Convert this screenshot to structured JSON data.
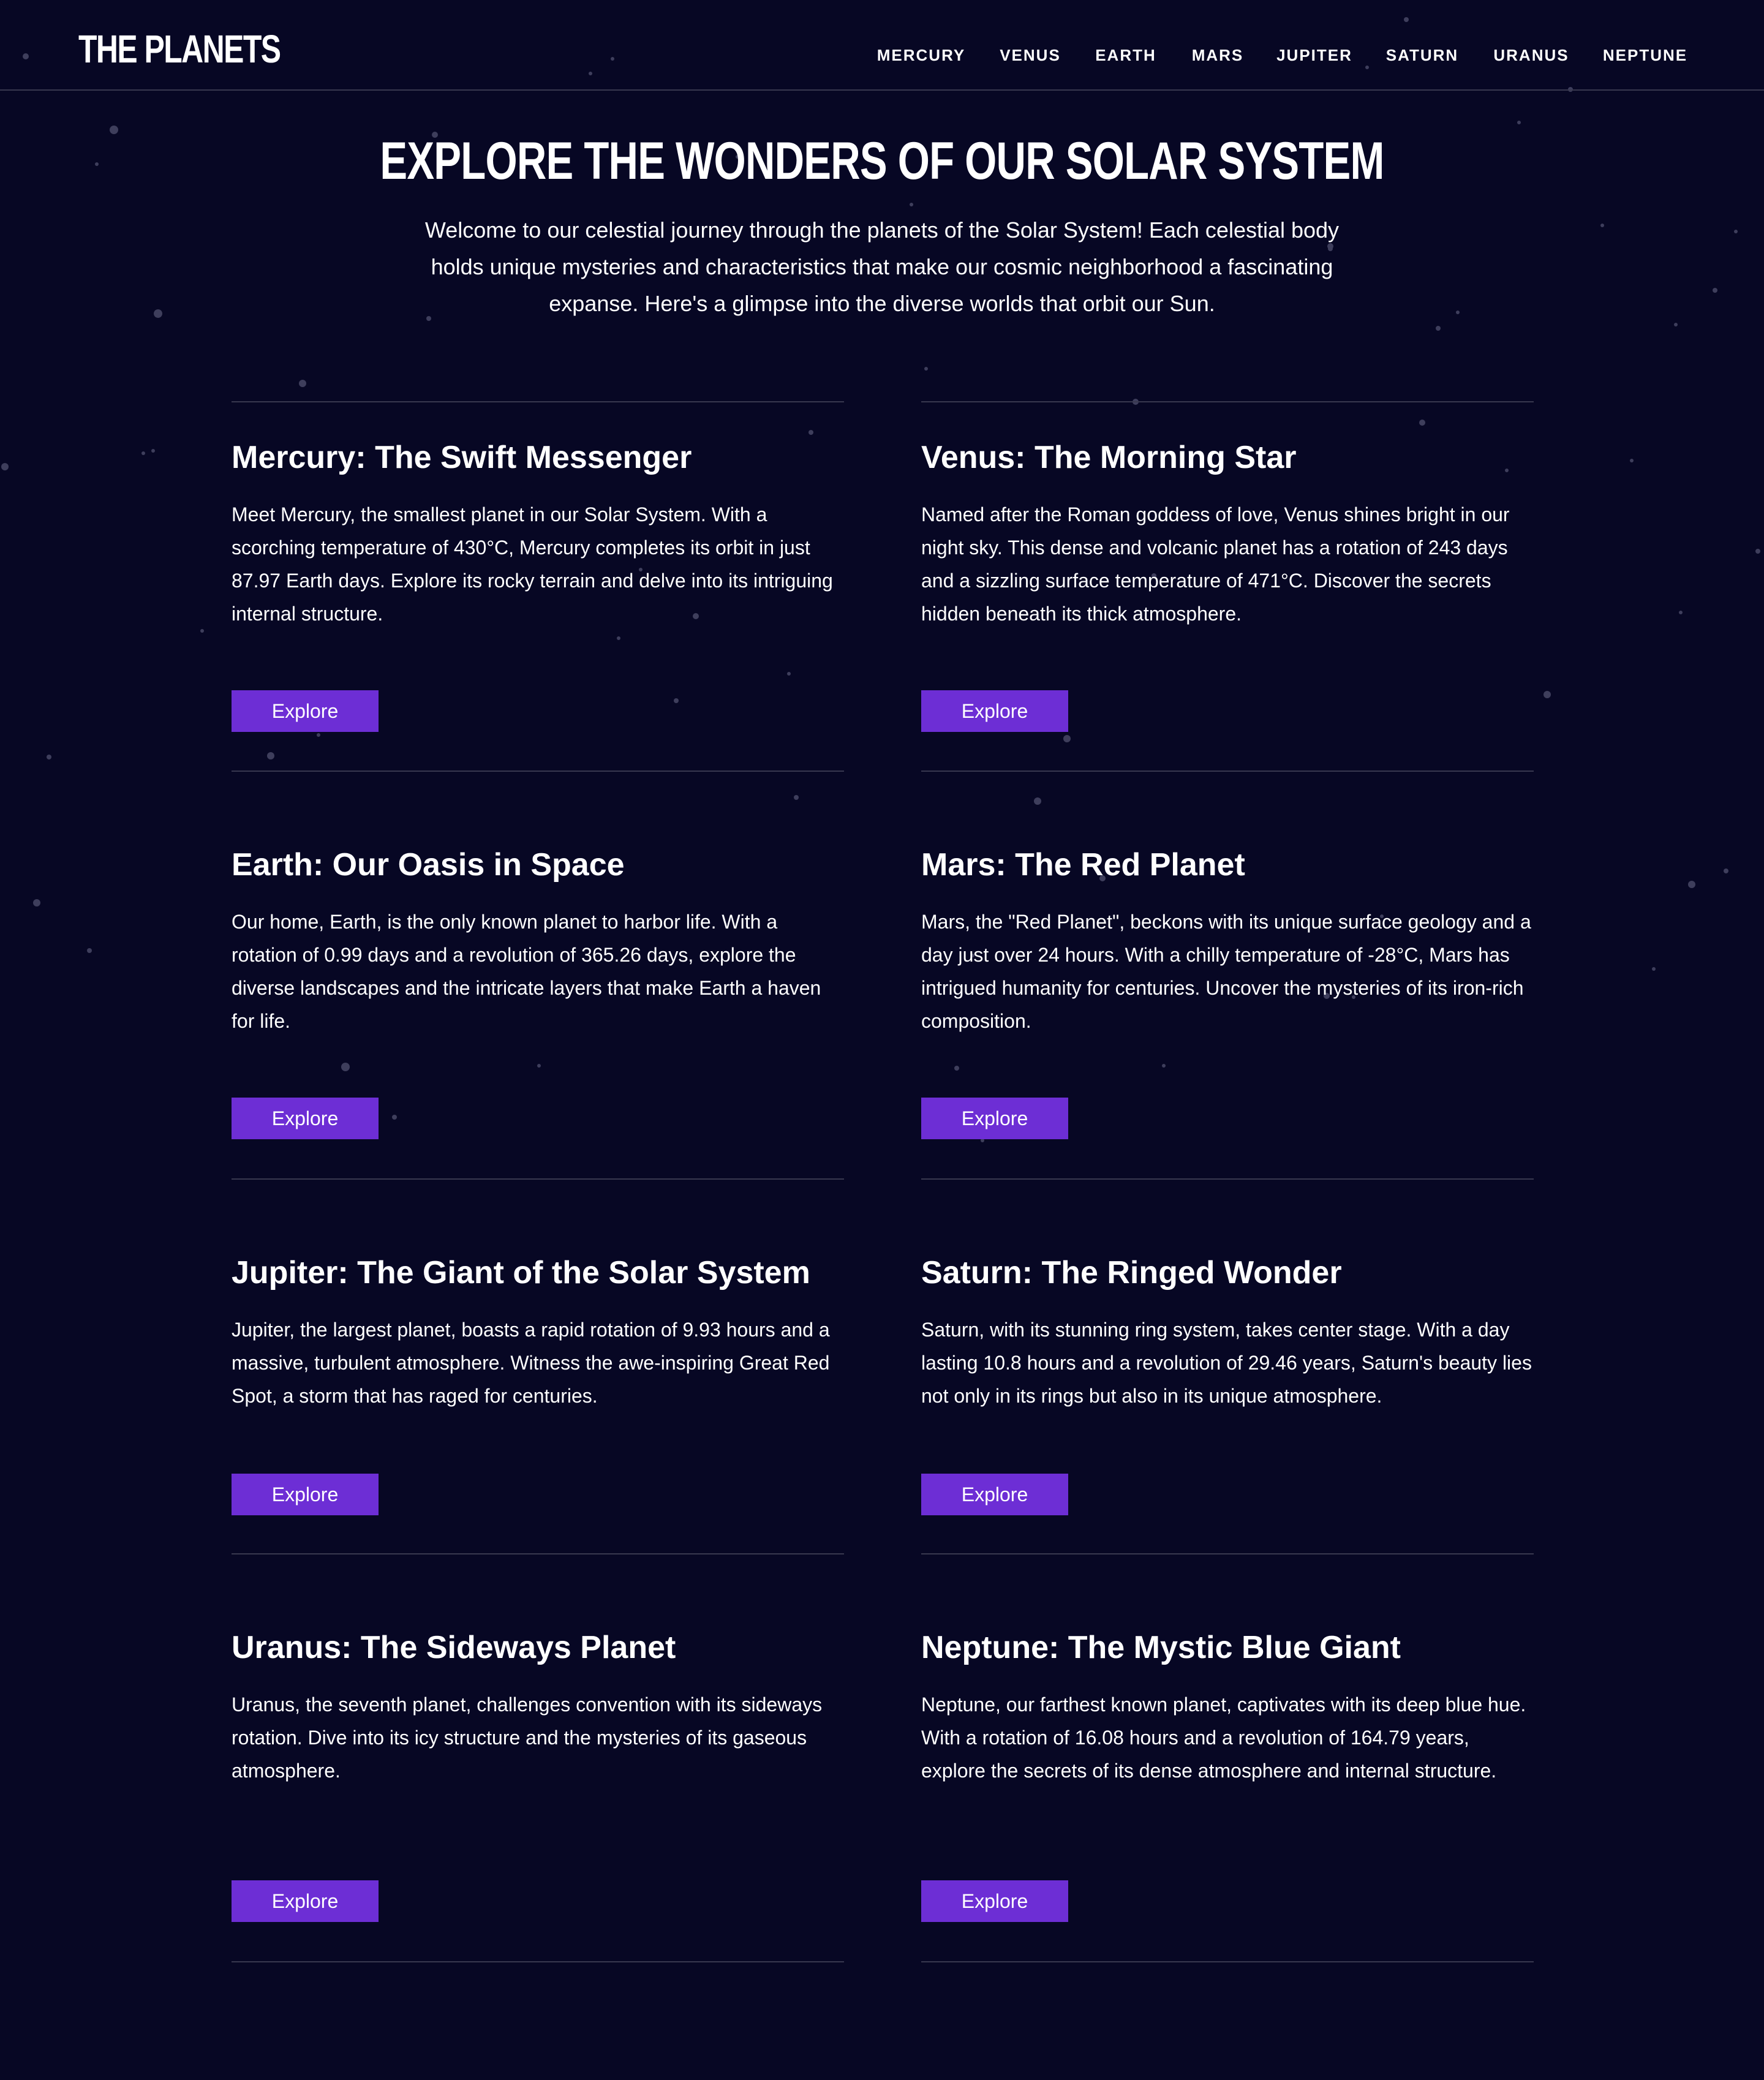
{
  "header": {
    "logo": "THE PLANETS",
    "nav": [
      "MERCURY",
      "VENUS",
      "EARTH",
      "MARS",
      "JUPITER",
      "SATURN",
      "URANUS",
      "NEPTUNE"
    ]
  },
  "hero": {
    "title": "EXPLORE THE WONDERS OF OUR SOLAR SYSTEM",
    "text": "Welcome to our celestial journey through the planets of the Solar System! Each celestial body holds unique mysteries and characteristics that make our cosmic neighborhood a fascinating expanse. Here's a glimpse into the diverse worlds that orbit our Sun."
  },
  "planets": [
    {
      "title": "Mercury: The Swift Messenger",
      "text": "Meet Mercury, the smallest planet in our Solar System. With a scorching temperature of 430°C, Mercury completes its orbit in just 87.97 Earth days. Explore its rocky terrain and delve into its intriguing internal structure.",
      "button": "Explore"
    },
    {
      "title": "Venus: The Morning Star",
      "text": "Named after the Roman goddess of love, Venus shines bright in our night sky. This dense and volcanic planet has a rotation of 243 days and a sizzling surface temperature of 471°C. Discover the secrets hidden beneath its thick atmosphere.",
      "button": "Explore"
    },
    {
      "title": "Earth: Our Oasis in Space",
      "text": "Our home, Earth, is the only known planet to harbor life. With a rotation of 0.99 days and a revolution of 365.26 days, explore the diverse landscapes and the intricate layers that make Earth a haven for life.",
      "button": "Explore"
    },
    {
      "title": "Mars: The Red Planet",
      "text": "Mars, the \"Red Planet\", beckons with its unique surface geology and a day just over 24 hours. With a chilly temperature of -28°C, Mars has intrigued humanity for centuries. Uncover the mysteries of its iron-rich composition.",
      "button": "Explore"
    },
    {
      "title": "Jupiter: The Giant of the Solar System",
      "text": "Jupiter, the largest planet, boasts a rapid rotation of 9.93 hours and a massive, turbulent atmosphere. Witness the awe-inspiring Great Red Spot, a storm that has raged for centuries.",
      "button": "Explore"
    },
    {
      "title": "Saturn: The Ringed Wonder",
      "text": "Saturn, with its stunning ring system, takes center stage. With a day lasting 10.8 hours and a revolution of 29.46 years, Saturn's beauty lies not only in its rings but also in its unique atmosphere.",
      "button": "Explore"
    },
    {
      "title": "Uranus: The Sideways Planet",
      "text": "Uranus, the seventh planet, challenges convention with its sideways rotation. Dive into its icy structure and the mysteries of its gaseous atmosphere.",
      "button": "Explore"
    },
    {
      "title": "Neptune: The Mystic Blue Giant",
      "text": "Neptune, our farthest known planet, captivates with its deep blue hue. With a rotation of 16.08 hours and a revolution of 164.79 years, explore the secrets of its dense atmosphere and internal structure.",
      "button": "Explore"
    }
  ],
  "colors": {
    "background": "#070724",
    "accent": "#6d2ed5",
    "divider": "#38384f",
    "text": "#ffffff"
  }
}
